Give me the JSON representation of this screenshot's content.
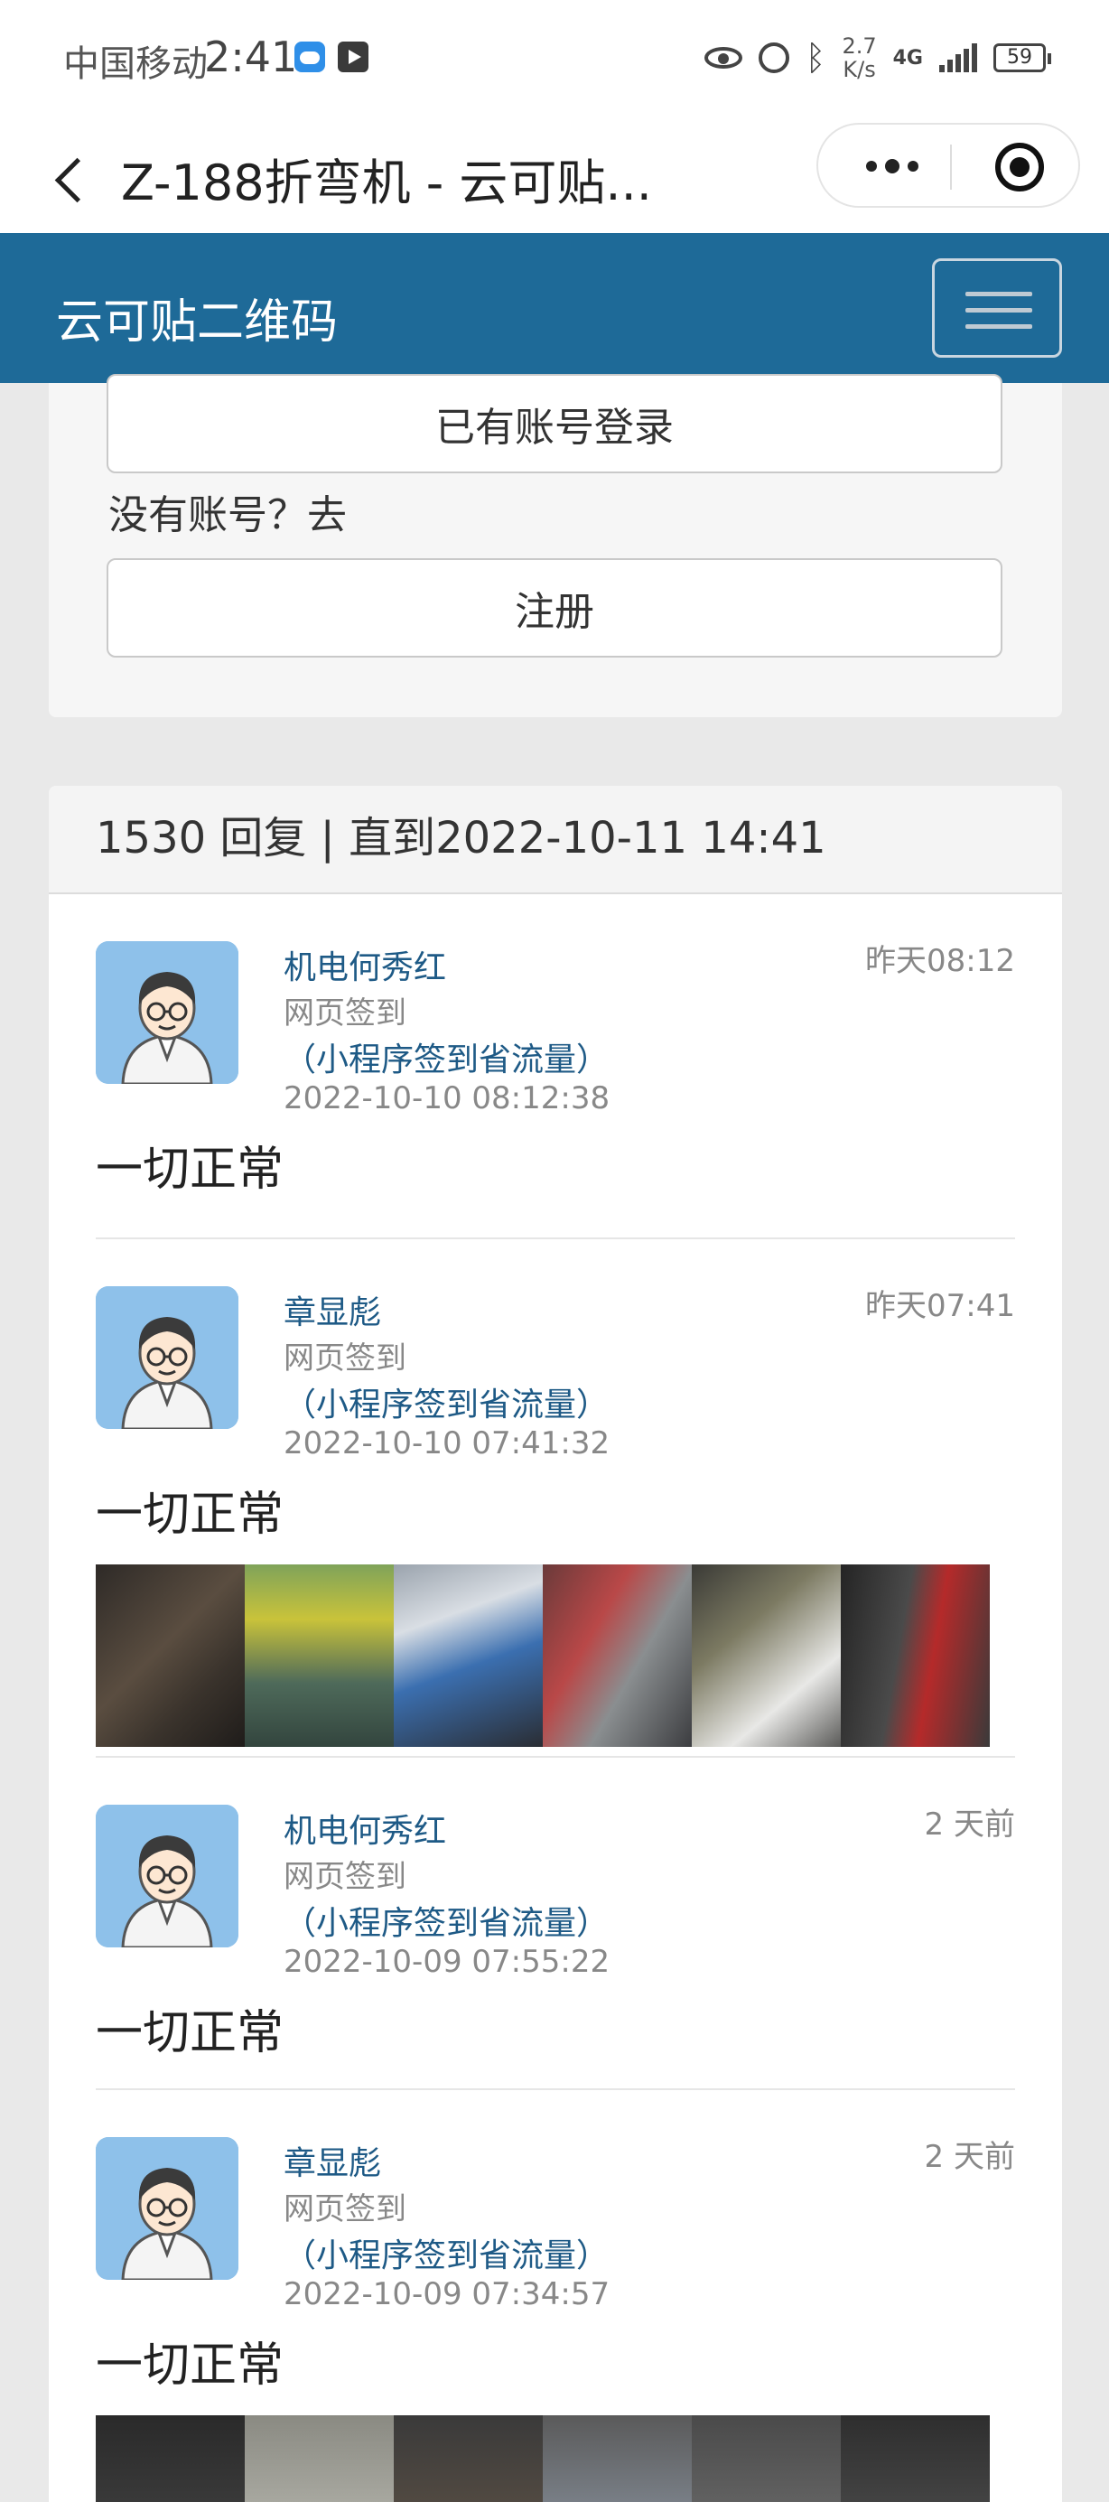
{
  "status_bar": {
    "carrier": "中国移动",
    "time": "2:41",
    "speed_top": "2.7",
    "speed_unit": "K/s",
    "network": "4G",
    "battery": "59"
  },
  "nav": {
    "title": "Z-188折弯机 - 云可贴..."
  },
  "site": {
    "brand": "云可贴二维码"
  },
  "login": {
    "login_button": "已有账号登录",
    "no_account": "没有账号？去",
    "register_button": "注册"
  },
  "replies": {
    "header": "1530 回复 | 直到2022-10-11 14:41",
    "items": [
      {
        "name": "机电何秀红",
        "time": "昨天08:12",
        "type": "网页签到",
        "link": "（小程序签到省流量）",
        "date": "2022-10-10 08:12:38",
        "text": "一切正常"
      },
      {
        "name": "章显彪",
        "time": "昨天07:41",
        "type": "网页签到",
        "link": "（小程序签到省流量）",
        "date": "2022-10-10 07:41:32",
        "text": "一切正常"
      },
      {
        "name": "机电何秀红",
        "time": "2 天前",
        "type": "网页签到",
        "link": "（小程序签到省流量）",
        "date": "2022-10-09 07:55:22",
        "text": "一切正常"
      },
      {
        "name": "章显彪",
        "time": "2 天前",
        "type": "网页签到",
        "link": "（小程序签到省流量）",
        "date": "2022-10-09 07:34:57",
        "text": "一切正常"
      }
    ]
  },
  "colors": {
    "header_bg": "#1e6a98",
    "link": "#1e5a86",
    "avatar_bg": "#8ec1ea"
  }
}
